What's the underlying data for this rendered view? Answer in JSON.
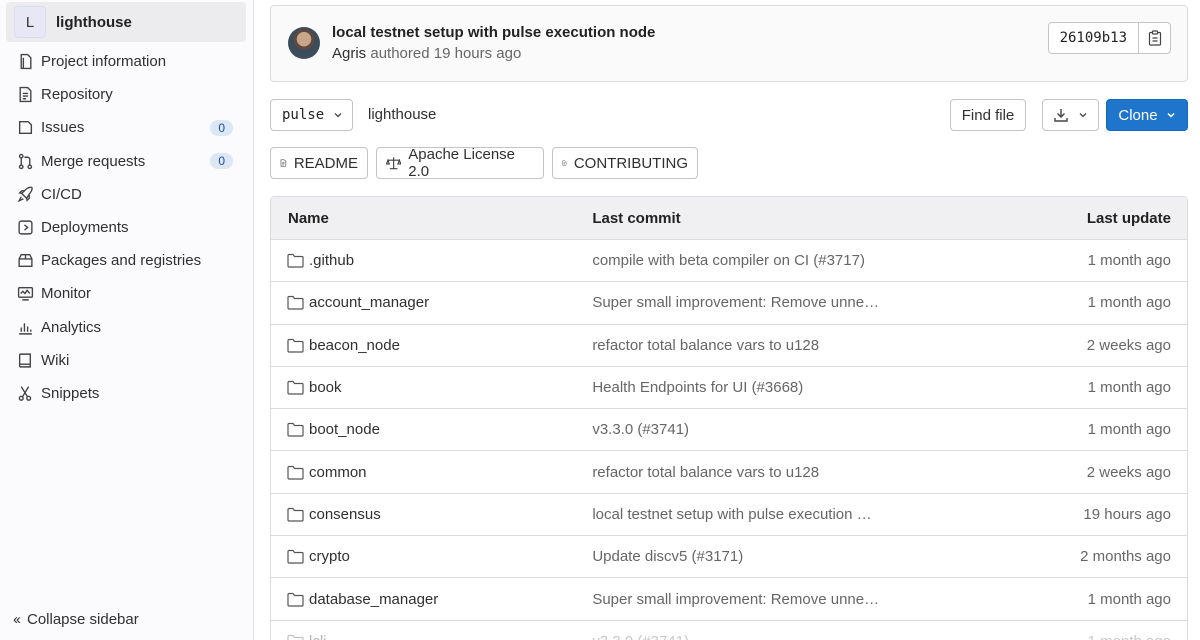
{
  "sidebar": {
    "project_initial": "L",
    "project_name": "lighthouse",
    "items": [
      {
        "label": "Project information",
        "icon": "project-icon"
      },
      {
        "label": "Repository",
        "icon": "document-icon"
      },
      {
        "label": "Issues",
        "icon": "issues-icon",
        "count": "0"
      },
      {
        "label": "Merge requests",
        "icon": "merge-request-icon",
        "count": "0"
      },
      {
        "label": "CI/CD",
        "icon": "rocket-icon"
      },
      {
        "label": "Deployments",
        "icon": "deployments-icon"
      },
      {
        "label": "Packages and registries",
        "icon": "package-icon"
      },
      {
        "label": "Monitor",
        "icon": "monitor-icon"
      },
      {
        "label": "Analytics",
        "icon": "chart-icon"
      },
      {
        "label": "Wiki",
        "icon": "book-icon"
      },
      {
        "label": "Snippets",
        "icon": "scissors-icon"
      }
    ],
    "collapse_label": "Collapse sidebar"
  },
  "commit": {
    "title": "local testnet setup with pulse execution node",
    "author": "Agris",
    "meta": "authored 19 hours ago",
    "sha": "26109b13"
  },
  "toolbar": {
    "branch": "pulse",
    "breadcrumb": "lighthouse",
    "find_file": "Find file",
    "clone": "Clone"
  },
  "badges": [
    "README",
    "Apache License 2.0",
    "CONTRIBUTING"
  ],
  "table": {
    "headers": {
      "name": "Name",
      "commit": "Last commit",
      "update": "Last update"
    },
    "rows": [
      {
        "name": ".github",
        "commit": "compile with beta compiler on CI (#3717)",
        "update": "1 month ago"
      },
      {
        "name": "account_manager",
        "commit": "Super small improvement: Remove unne…",
        "update": "1 month ago"
      },
      {
        "name": "beacon_node",
        "commit": "refactor total balance vars to u128",
        "update": "2 weeks ago"
      },
      {
        "name": "book",
        "commit": "Health Endpoints for UI (#3668)",
        "update": "1 month ago"
      },
      {
        "name": "boot_node",
        "commit": "v3.3.0 (#3741)",
        "update": "1 month ago"
      },
      {
        "name": "common",
        "commit": "refactor total balance vars to u128",
        "update": "2 weeks ago"
      },
      {
        "name": "consensus",
        "commit": "local testnet setup with pulse execution …",
        "update": "19 hours ago"
      },
      {
        "name": "crypto",
        "commit": "Update discv5 (#3171)",
        "update": "2 months ago"
      },
      {
        "name": "database_manager",
        "commit": "Super small improvement: Remove unne…",
        "update": "1 month ago"
      },
      {
        "name": "lcli",
        "commit": "v3.3.0 (#3741)",
        "update": "1 month ago"
      }
    ]
  },
  "colors": {
    "accent": "#1f75cb",
    "sidebar_bg": "#fbfafd",
    "header_bg": "#f0f0f2"
  }
}
